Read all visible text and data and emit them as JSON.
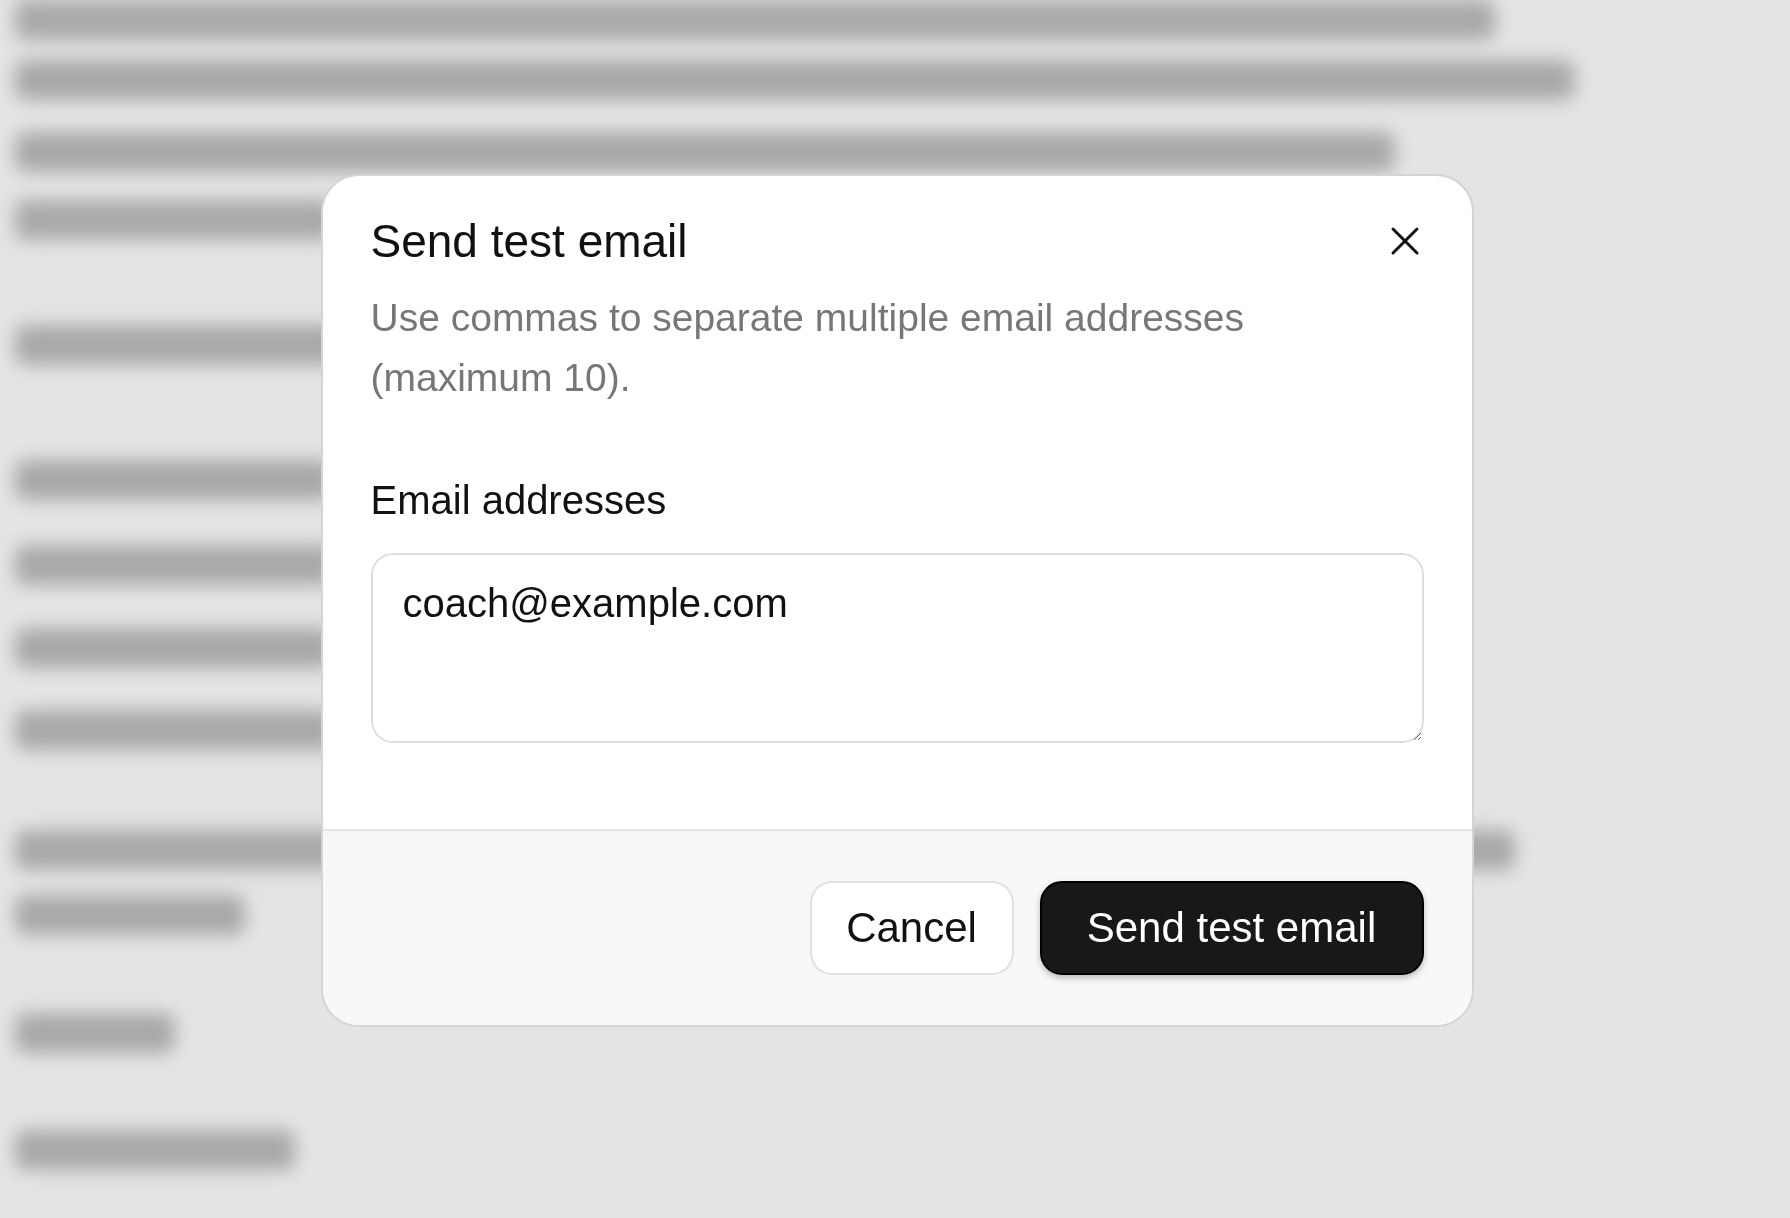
{
  "dialog": {
    "title": "Send test email",
    "description": "Use commas to separate multiple email addresses (maximum 10).",
    "field": {
      "label": "Email addresses",
      "value": "coach@example.com"
    },
    "buttons": [
      {
        "label": "Cancel",
        "kind": "secondary"
      },
      {
        "label": "Send test email",
        "kind": "primary"
      }
    ]
  }
}
